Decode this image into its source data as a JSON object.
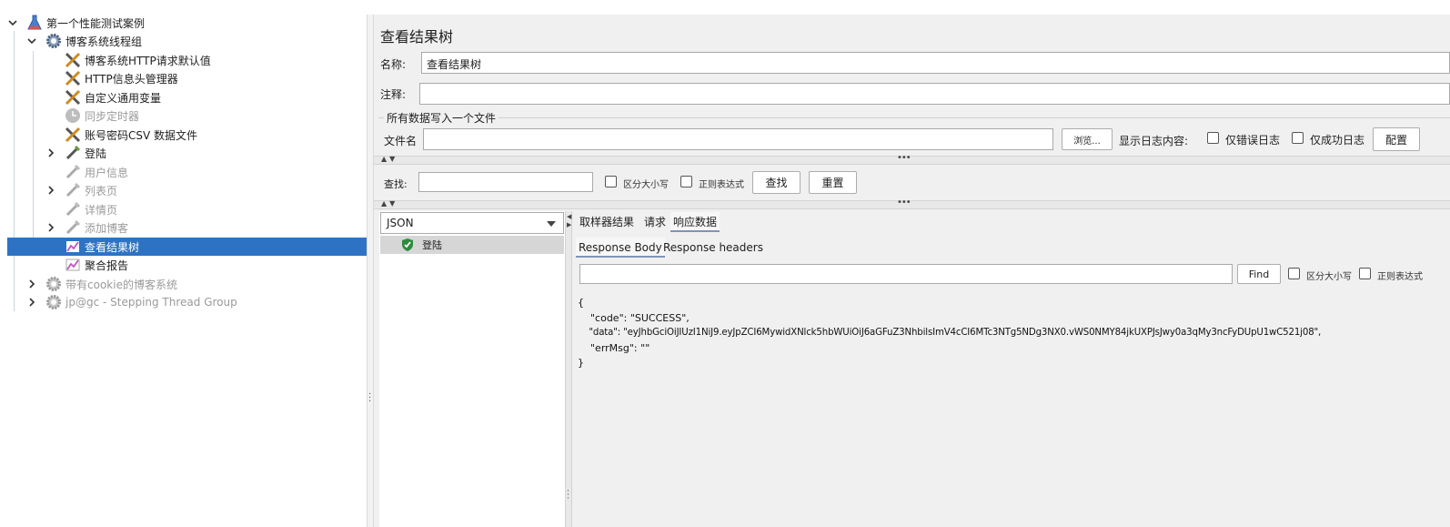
{
  "tree": {
    "items": [
      {
        "label": "第一个性能测试案例"
      },
      {
        "label": "博客系统线程组"
      },
      {
        "label": "博客系统HTTP请求默认值"
      },
      {
        "label": "HTTP信息头管理器"
      },
      {
        "label": "自定义通用变量"
      },
      {
        "label": "同步定时器"
      },
      {
        "label": "账号密码CSV 数据文件"
      },
      {
        "label": "登陆"
      },
      {
        "label": "用户信息"
      },
      {
        "label": "列表页"
      },
      {
        "label": "详情页"
      },
      {
        "label": "添加博客"
      },
      {
        "label": "查看结果树"
      },
      {
        "label": "聚合报告"
      },
      {
        "label": "带有cookie的博客系统"
      },
      {
        "label": "jp@gc - Stepping Thread Group"
      }
    ]
  },
  "panel": {
    "title": "查看结果树",
    "name_label": "名称:",
    "name_value": "查看结果树",
    "comment_label": "注释:",
    "comment_value": "",
    "file_group_label": "所有数据写入一个文件",
    "filename_label": "文件名",
    "filename_value": "",
    "browse_button": "浏览...",
    "log_content_label": "显示日志内容:",
    "errors_only_label": "仅错误日志",
    "success_only_label": "仅成功日志",
    "configure_button": "配置",
    "search_label": "查找:",
    "search_value": "",
    "case_sensitive_label": "区分大小写",
    "regex_label": "正则表达式",
    "find_button": "查找",
    "reset_button": "重置"
  },
  "results": {
    "renderer": "JSON",
    "samples": [
      {
        "label": "登陆",
        "status": "success"
      }
    ],
    "tabs": [
      {
        "label": "取样器结果"
      },
      {
        "label": "请求"
      },
      {
        "label": "响应数据"
      }
    ],
    "subtabs": [
      {
        "label": "Response Body"
      },
      {
        "label": "Response headers"
      }
    ],
    "find_value": "",
    "find_button": "Find",
    "case_label": "区分大小写",
    "regex_label": "正则表达式",
    "body_lines": [
      "{",
      "    \"code\": \"SUCCESS\",",
      "    \"data\": \"eyJhbGciOiJIUzI1NiJ9.eyJpZCI6MywidXNlck5hbWUiOiJ6aGFuZ3NhbilsImV4cCI6MTc3NTg5NDg3NX0.vWS0NMY84jkUXPJsJwy0a3qMy3ncFyDUpU1wC521j08\",",
      "    \"errMsg\": \"\"",
      "}"
    ]
  },
  "colors": {
    "selection": "#2e73c3",
    "panel_bg": "#f0f0f0",
    "success": "#2e8b3e"
  }
}
